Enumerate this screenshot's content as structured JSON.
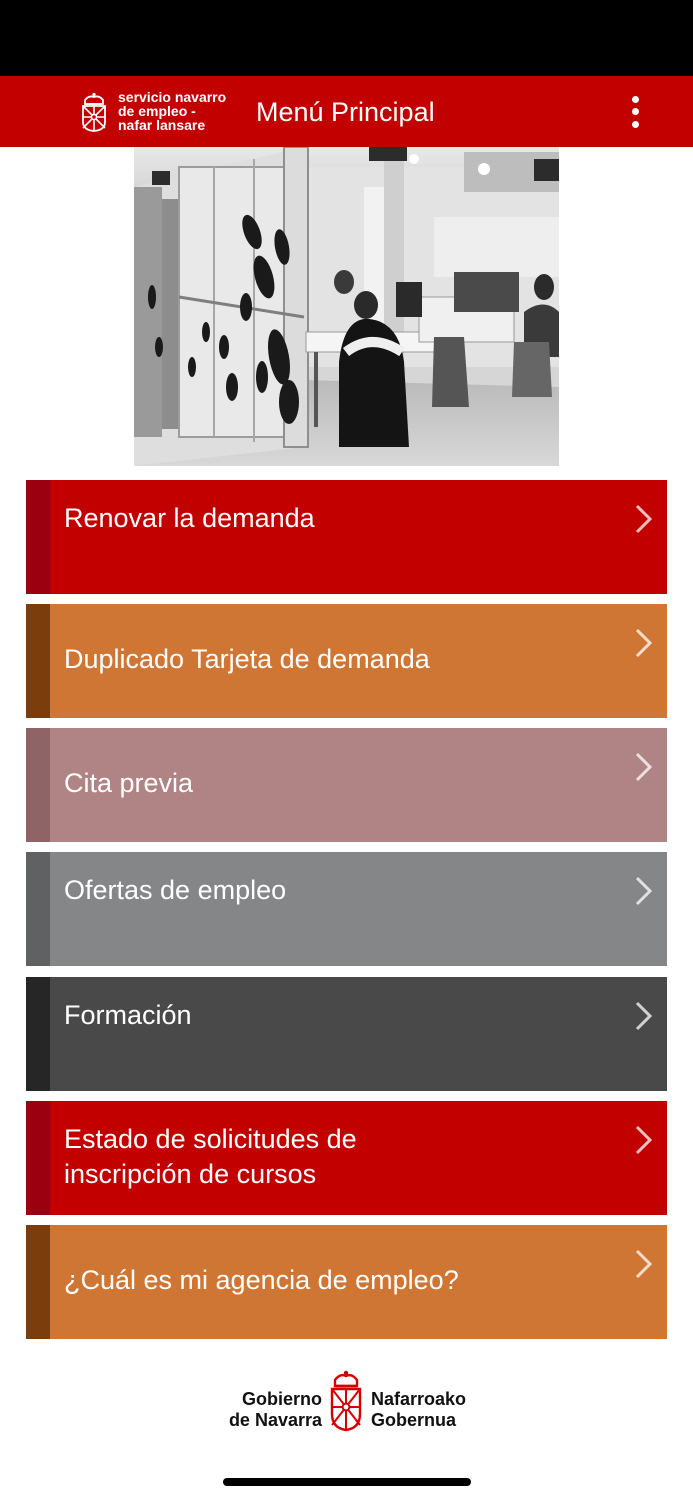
{
  "header": {
    "brand_lines": [
      "servicio navarro",
      "de empleo -",
      "nafar lansare"
    ],
    "title": "Menú Principal",
    "menu_icon": "more-vertical-icon",
    "crest_icon": "navarra-crest-icon"
  },
  "hero": {
    "image": "office-photo-black-and-white"
  },
  "menu": {
    "items": [
      {
        "label_lines": [
          "Renovar la demanda"
        ],
        "color": "#c20000",
        "stripe": "#9a0010"
      },
      {
        "label_lines": [
          "Duplicado Tarjeta de demanda"
        ],
        "color": "#d07635",
        "stripe": "#7c3d0c"
      },
      {
        "label_lines": [
          "Cita previa"
        ],
        "color": "#b08384",
        "stripe": "#8f6466"
      },
      {
        "label_lines": [
          "Ofertas de empleo"
        ],
        "color": "#858687",
        "stripe": "#606162"
      },
      {
        "label_lines": [
          "Formación"
        ],
        "color": "#494949",
        "stripe": "#262626"
      },
      {
        "label_lines": [
          "Estado de solicitudes de",
          "inscripción de cursos"
        ],
        "color": "#c20000",
        "stripe": "#9a0010"
      },
      {
        "label_lines": [
          "¿Cuál es mi agencia de empleo?"
        ],
        "color": "#d07635",
        "stripe": "#7c3d0c"
      }
    ],
    "chevron_icon": "chevron-right-icon"
  },
  "footer": {
    "left_lines": [
      "Gobierno",
      "de Navarra"
    ],
    "right_lines": [
      "Nafarroako",
      "Gobernua"
    ],
    "crest_icon": "navarra-crest-icon"
  },
  "colors": {
    "brand_red": "#c20000",
    "status_bar": "#000000"
  }
}
